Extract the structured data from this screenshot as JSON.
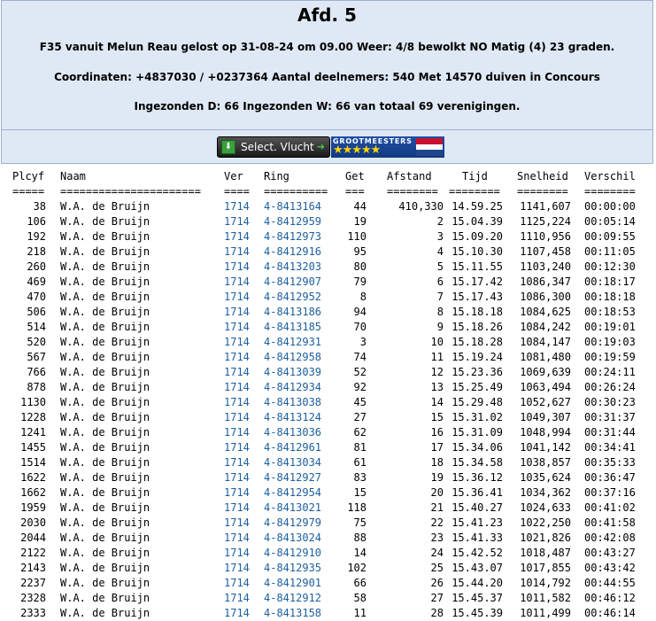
{
  "header": {
    "title": "Afd. 5",
    "line1": "F35 vanuit Melun Reau gelost op 31-08-24 om 09.00 Weer: 4/8 bewolkt NO Matig (4) 23 graden.",
    "line2": "Coordinaten: +4837030 / +0237364 Aantal deelnemers: 540 Met 14570 duiven in Concours",
    "line3": "Ingezonden D: 66 Ingezonden W: 66 van totaal 69 verenigingen."
  },
  "toolbar": {
    "select_label": "Select. Vlucht",
    "gm_label": "GROOTMEESTERS",
    "gm_stars": "★★★★★",
    "colors": {
      "flag_red": "#c8102e",
      "flag_white": "#ffffff",
      "flag_blue": "#21468b"
    }
  },
  "table": {
    "columns": [
      "Plcyf",
      "Naam",
      "Ver",
      "Ring",
      "Get",
      "Afstand",
      "Tijd",
      "Snelheid",
      "Verschil"
    ],
    "rules": [
      "=====",
      "======================",
      "====",
      "==========",
      "===",
      "========",
      "========",
      "========",
      "========"
    ],
    "rows": [
      [
        "38",
        "W.A. de Bruijn",
        "1714",
        "4-8413164",
        "44",
        "410,330",
        "14.59.25",
        "1141,607",
        "00:00:00"
      ],
      [
        "106",
        "W.A. de Bruijn",
        "1714",
        "4-8412959",
        "19",
        "2",
        "15.04.39",
        "1125,224",
        "00:05:14"
      ],
      [
        "192",
        "W.A. de Bruijn",
        "1714",
        "4-8412973",
        "110",
        "3",
        "15.09.20",
        "1110,956",
        "00:09:55"
      ],
      [
        "218",
        "W.A. de Bruijn",
        "1714",
        "4-8412916",
        "95",
        "4",
        "15.10.30",
        "1107,458",
        "00:11:05"
      ],
      [
        "260",
        "W.A. de Bruijn",
        "1714",
        "4-8413203",
        "80",
        "5",
        "15.11.55",
        "1103,240",
        "00:12:30"
      ],
      [
        "469",
        "W.A. de Bruijn",
        "1714",
        "4-8412907",
        "79",
        "6",
        "15.17.42",
        "1086,347",
        "00:18:17"
      ],
      [
        "470",
        "W.A. de Bruijn",
        "1714",
        "4-8412952",
        "8",
        "7",
        "15.17.43",
        "1086,300",
        "00:18:18"
      ],
      [
        "506",
        "W.A. de Bruijn",
        "1714",
        "4-8413186",
        "94",
        "8",
        "15.18.18",
        "1084,625",
        "00:18:53"
      ],
      [
        "514",
        "W.A. de Bruijn",
        "1714",
        "4-8413185",
        "70",
        "9",
        "15.18.26",
        "1084,242",
        "00:19:01"
      ],
      [
        "520",
        "W.A. de Bruijn",
        "1714",
        "4-8412931",
        "3",
        "10",
        "15.18.28",
        "1084,147",
        "00:19:03"
      ],
      [
        "567",
        "W.A. de Bruijn",
        "1714",
        "4-8412958",
        "74",
        "11",
        "15.19.24",
        "1081,480",
        "00:19:59"
      ],
      [
        "766",
        "W.A. de Bruijn",
        "1714",
        "4-8413039",
        "52",
        "12",
        "15.23.36",
        "1069,639",
        "00:24:11"
      ],
      [
        "878",
        "W.A. de Bruijn",
        "1714",
        "4-8412934",
        "92",
        "13",
        "15.25.49",
        "1063,494",
        "00:26:24"
      ],
      [
        "1130",
        "W.A. de Bruijn",
        "1714",
        "4-8413038",
        "45",
        "14",
        "15.29.48",
        "1052,627",
        "00:30:23"
      ],
      [
        "1228",
        "W.A. de Bruijn",
        "1714",
        "4-8413124",
        "27",
        "15",
        "15.31.02",
        "1049,307",
        "00:31:37"
      ],
      [
        "1241",
        "W.A. de Bruijn",
        "1714",
        "4-8413036",
        "62",
        "16",
        "15.31.09",
        "1048,994",
        "00:31:44"
      ],
      [
        "1455",
        "W.A. de Bruijn",
        "1714",
        "4-8412961",
        "81",
        "17",
        "15.34.06",
        "1041,142",
        "00:34:41"
      ],
      [
        "1514",
        "W.A. de Bruijn",
        "1714",
        "4-8413034",
        "61",
        "18",
        "15.34.58",
        "1038,857",
        "00:35:33"
      ],
      [
        "1622",
        "W.A. de Bruijn",
        "1714",
        "4-8412927",
        "83",
        "19",
        "15.36.12",
        "1035,624",
        "00:36:47"
      ],
      [
        "1662",
        "W.A. de Bruijn",
        "1714",
        "4-8412954",
        "15",
        "20",
        "15.36.41",
        "1034,362",
        "00:37:16"
      ],
      [
        "1959",
        "W.A. de Bruijn",
        "1714",
        "4-8413021",
        "118",
        "21",
        "15.40.27",
        "1024,633",
        "00:41:02"
      ],
      [
        "2030",
        "W.A. de Bruijn",
        "1714",
        "4-8412979",
        "75",
        "22",
        "15.41.23",
        "1022,250",
        "00:41:58"
      ],
      [
        "2044",
        "W.A. de Bruijn",
        "1714",
        "4-8413024",
        "88",
        "23",
        "15.41.33",
        "1021,826",
        "00:42:08"
      ],
      [
        "2122",
        "W.A. de Bruijn",
        "1714",
        "4-8412910",
        "14",
        "24",
        "15.42.52",
        "1018,487",
        "00:43:27"
      ],
      [
        "2143",
        "W.A. de Bruijn",
        "1714",
        "4-8412935",
        "102",
        "25",
        "15.43.07",
        "1017,855",
        "00:43:42"
      ],
      [
        "2237",
        "W.A. de Bruijn",
        "1714",
        "4-8412901",
        "66",
        "26",
        "15.44.20",
        "1014,792",
        "00:44:55"
      ],
      [
        "2328",
        "W.A. de Bruijn",
        "1714",
        "4-8412912",
        "58",
        "27",
        "15.45.37",
        "1011,582",
        "00:46:12"
      ],
      [
        "2333",
        "W.A. de Bruijn",
        "1714",
        "4-8413158",
        "11",
        "28",
        "15.45.39",
        "1011,499",
        "00:46:14"
      ]
    ]
  }
}
